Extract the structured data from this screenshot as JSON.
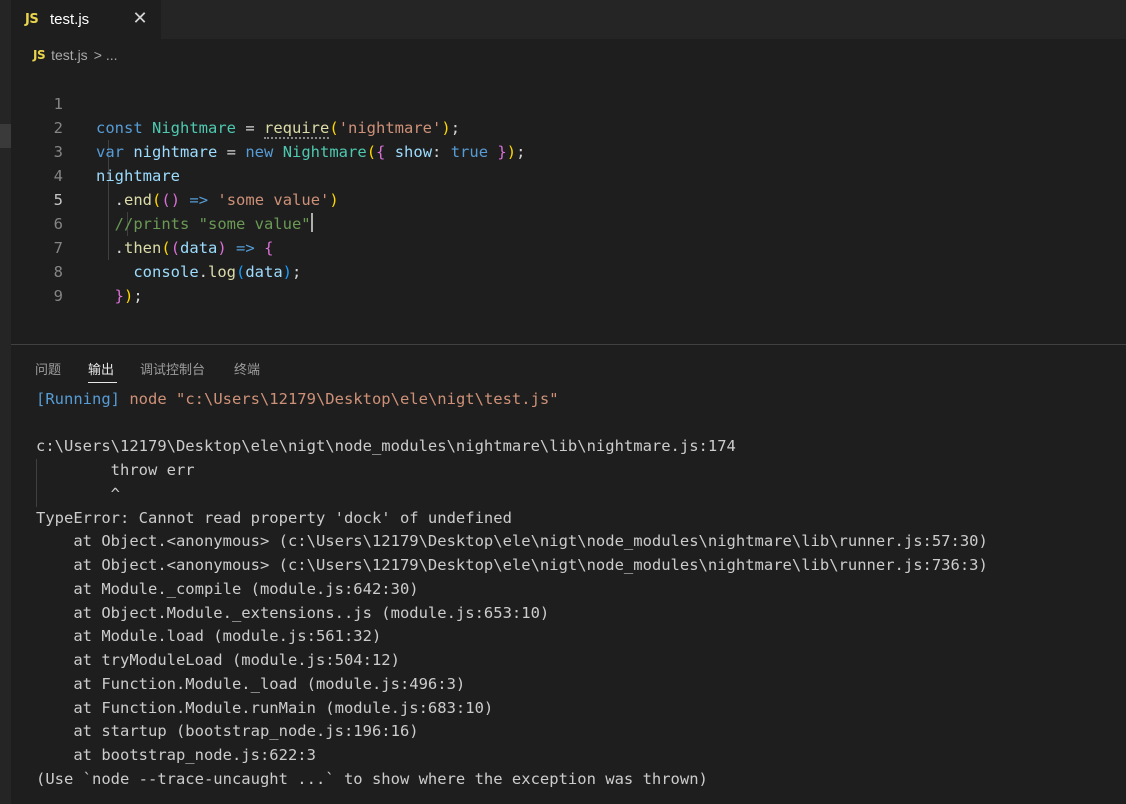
{
  "tab": {
    "lang_badge": "JS",
    "title": "test.js",
    "close_glyph": "✕"
  },
  "breadcrumb": {
    "lang_badge": "JS",
    "file": "test.js",
    "separator": ">",
    "more": "..."
  },
  "editor": {
    "line_numbers": [
      "1",
      "2",
      "3",
      "4",
      "5",
      "6",
      "7",
      "8",
      "9"
    ],
    "active_line": 5,
    "tokens": {
      "l1_kw": "const",
      "l1_name": "Nightmare",
      "l1_eq": " = ",
      "l1_fn": "require",
      "l1_p_open": "(",
      "l1_str": "'nightmare'",
      "l1_p_close": ")",
      "l1_semi": ";",
      "l2_kw": "var",
      "l2_var": "nightmare",
      "l2_eq": " = ",
      "l2_new": "new",
      "l2_cls": "Nightmare",
      "l2_p_open": "(",
      "l2_b_open": "{",
      "l2_prop": "show",
      "l2_colon": ": ",
      "l2_true": "true",
      "l2_b_close": "}",
      "l2_p_close": ")",
      "l2_semi": ";",
      "l3_var": "nightmare",
      "l4_dot": ".",
      "l4_fn": "end",
      "l4_p1": "(",
      "l4_p2": "()",
      "l4_arrow": "=>",
      "l4_str": "'some value'",
      "l4_p1c": ")",
      "l5_cmt": "//prints \"some value\"",
      "l6_dot": ".",
      "l6_fn": "then",
      "l6_p1": "(",
      "l6_p2o": "(",
      "l6_arg": "data",
      "l6_p2c": ")",
      "l6_arrow": "=>",
      "l6_b": "{",
      "l7_obj": "console",
      "l7_dot": ".",
      "l7_fn": "log",
      "l7_po": "(",
      "l7_arg": "data",
      "l7_pc": ")",
      "l7_semi": ";",
      "l8_b": "}",
      "l8_p": ")",
      "l8_semi": ";"
    }
  },
  "panel": {
    "tabs": [
      "问题",
      "输出",
      "调试控制台",
      "终端"
    ],
    "active_tab": "输出",
    "output": {
      "running_tag": "[Running]",
      "running_cmd": " node \"c:\\Users\\12179\\Desktop\\ele\\nigt\\test.js\"",
      "lines": [
        "c:\\Users\\12179\\Desktop\\ele\\nigt\\node_modules\\nightmare\\lib\\nightmare.js:174",
        "        throw err",
        "        ^",
        "TypeError: Cannot read property 'dock' of undefined",
        "    at Object.<anonymous> (c:\\Users\\12179\\Desktop\\ele\\nigt\\node_modules\\nightmare\\lib\\runner.js:57:30)",
        "    at Object.<anonymous> (c:\\Users\\12179\\Desktop\\ele\\nigt\\node_modules\\nightmare\\lib\\runner.js:736:3)",
        "    at Module._compile (module.js:642:30)",
        "    at Object.Module._extensions..js (module.js:653:10)",
        "    at Module.load (module.js:561:32)",
        "    at tryModuleLoad (module.js:504:12)",
        "    at Function.Module._load (module.js:496:3)",
        "    at Function.Module.runMain (module.js:683:10)",
        "    at startup (bootstrap_node.js:196:16)",
        "    at bootstrap_node.js:622:3",
        "(Use `node --trace-uncaught ...` to show where the exception was thrown)"
      ]
    }
  },
  "colors": {
    "background": "#1e1e1e",
    "keyword": "#569cd6",
    "string": "#ce9178",
    "function": "#dcdcaa",
    "class": "#4ec9b0",
    "variable": "#9cdcfe",
    "comment": "#6a9955",
    "js_badge": "#e8d44d"
  }
}
